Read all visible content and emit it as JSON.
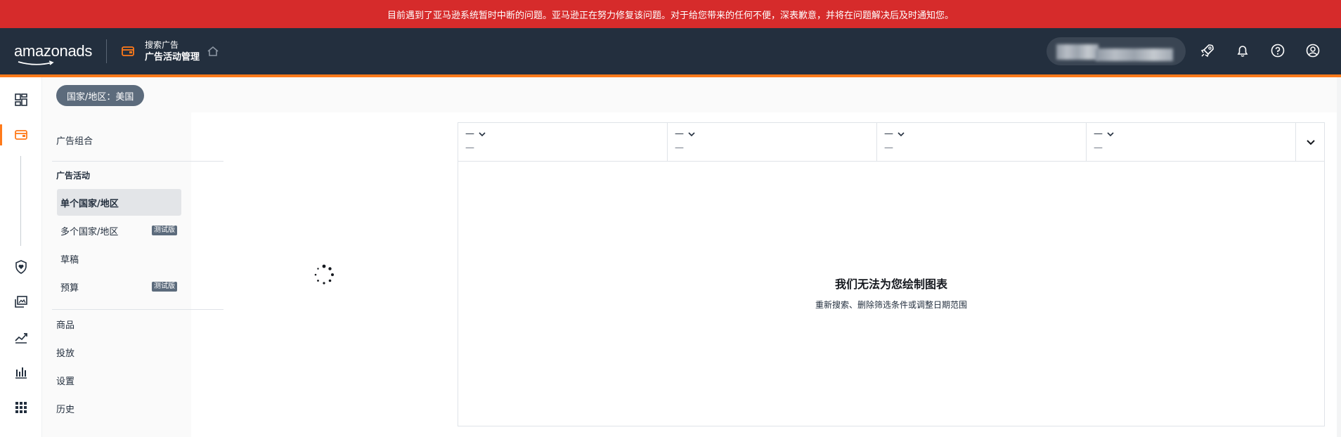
{
  "banner": {
    "text": "目前遇到了亚马逊系统暂时中断的问题。亚马逊正在努力修复该问题。对于给您带来的任何不便，深表歉意，并将在问题解决后及时通知您。"
  },
  "header": {
    "logo_main": "amazon",
    "logo_ads": "ads",
    "product_sub": "搜索广告",
    "product_main": "广告活动管理",
    "icons": [
      "rocket-icon",
      "bell-icon",
      "help-icon",
      "account-icon"
    ]
  },
  "rail": {
    "icons": [
      "dashboard-icon",
      "campaign-wallet-icon",
      "shield-heart-icon",
      "media-library-icon",
      "trend-chart-icon",
      "bar-chart-icon",
      "apps-grid-icon"
    ]
  },
  "subbar": {
    "country_chip": "国家/地区：美国"
  },
  "nav": {
    "portfolio": "广告组合",
    "campaigns_section": "广告活动",
    "single_country": "单个国家/地区",
    "multi_country": "多个国家/地区",
    "multi_country_badge": "测试版",
    "drafts": "草稿",
    "budgets": "预算",
    "budgets_badge": "测试版",
    "products": "商品",
    "targeting": "投放",
    "settings": "设置",
    "history": "历史"
  },
  "chart": {
    "metrics": [
      {
        "label": "—",
        "value": "—"
      },
      {
        "label": "—",
        "value": "—"
      },
      {
        "label": "—",
        "value": "—"
      },
      {
        "label": "—",
        "value": "—"
      }
    ],
    "empty_title": "我们无法为您绘制图表",
    "empty_subtitle": "重新搜索、删除筛选条件或调整日期范围"
  },
  "colors": {
    "banner": "#d62b2b",
    "topbar": "#232f3e",
    "accent": "#ff7a1a",
    "chip": "#5c6b7c"
  }
}
